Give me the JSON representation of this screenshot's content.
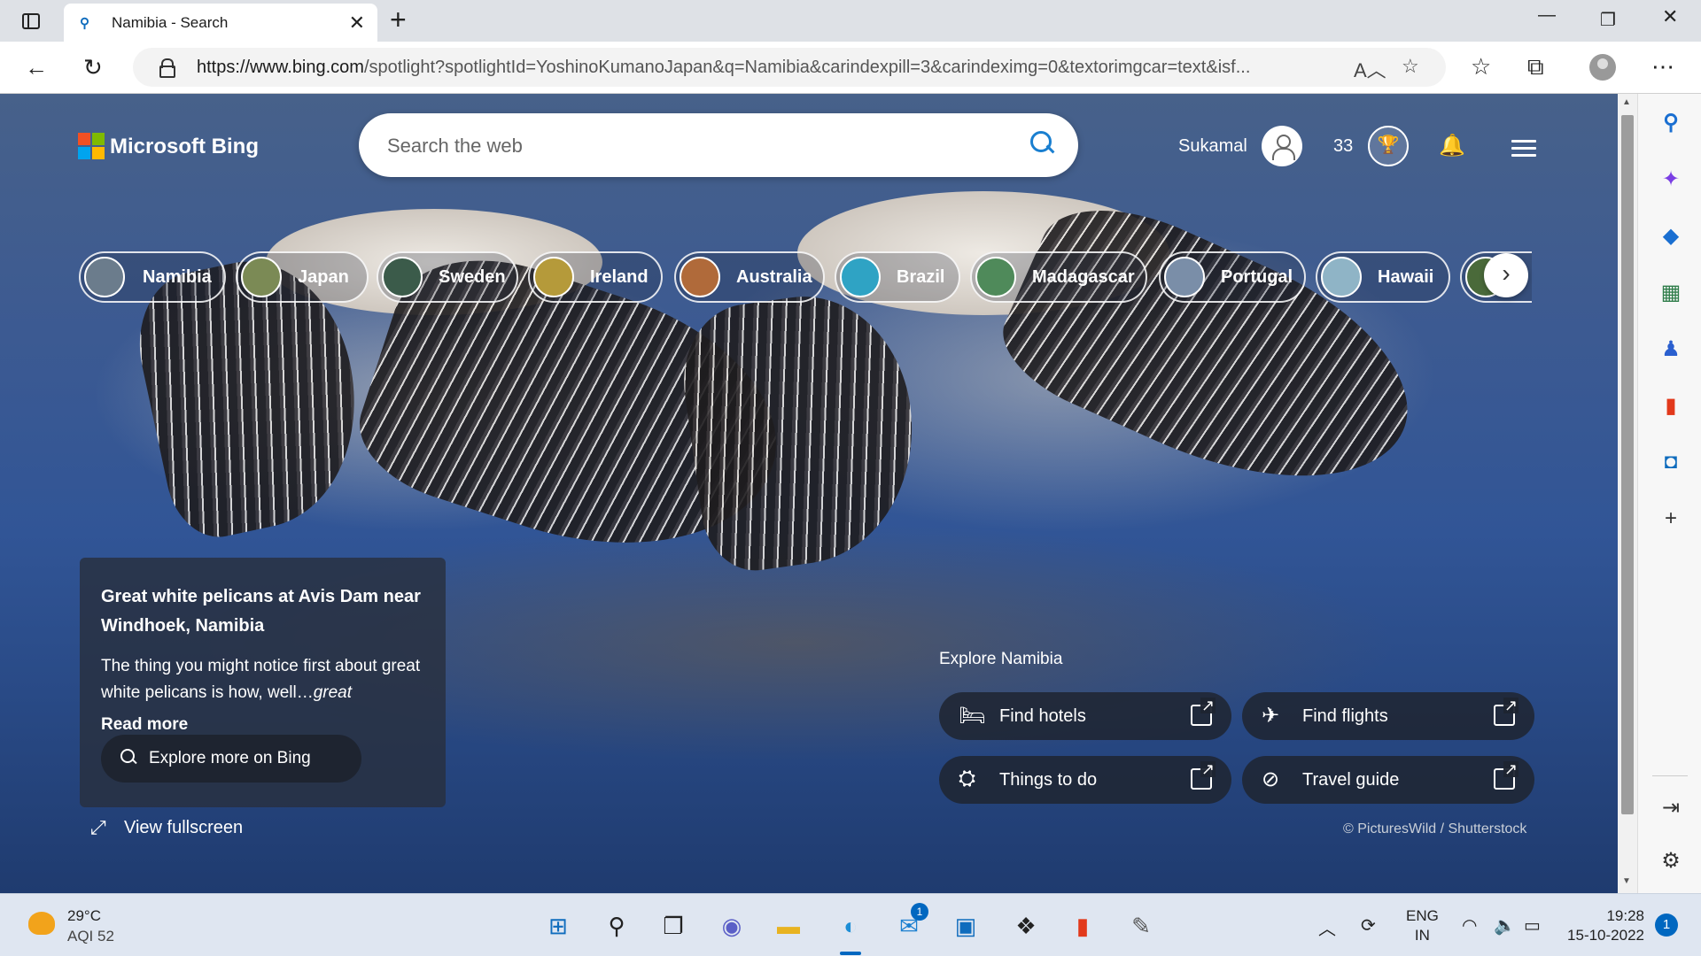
{
  "browser": {
    "tab_title": "Namibia - Search",
    "url_host": "https://www.bing.com",
    "url_rest": "/spotlight?spotlightId=YoshinoKumanoJapan&q=Namibia&carindexpill=3&carindeximg=0&textorimgcar=text&isf..."
  },
  "bing": {
    "logo_text": "Microsoft Bing",
    "search_placeholder": "Search the web",
    "user_name": "Sukamal",
    "points": "33",
    "pills": [
      {
        "label": "Namibia",
        "thumb_color": "#6b7c8c"
      },
      {
        "label": "Japan",
        "thumb_color": "#7b8a55"
      },
      {
        "label": "Sweden",
        "thumb_color": "#3b5b4a"
      },
      {
        "label": "Ireland",
        "thumb_color": "#b59a3a"
      },
      {
        "label": "Australia",
        "thumb_color": "#b06a3a"
      },
      {
        "label": "Brazil",
        "thumb_color": "#2fa3c4"
      },
      {
        "label": "Madagascar",
        "thumb_color": "#4f8a5a"
      },
      {
        "label": "Portugal",
        "thumb_color": "#7a8ea8"
      },
      {
        "label": "Hawaii",
        "thumb_color": "#8fb4c6"
      },
      {
        "label": "",
        "thumb_color": "#4a6a3a"
      }
    ],
    "info": {
      "headline": "Great white pelicans at Avis Dam near Windhoek, Namibia",
      "desc_plain": "The thing you might notice first about great white pelicans is how, well…",
      "desc_italic": "great",
      "read_more": "Read more",
      "explore_button": "Explore more on Bing"
    },
    "view_fullscreen": "View fullscreen",
    "explore_title": "Explore Namibia",
    "quick_links": [
      {
        "label": "Find hotels",
        "icon": "bed-icon",
        "glyph": "🛏"
      },
      {
        "label": "Find flights",
        "icon": "airplane-icon",
        "glyph": "✈"
      },
      {
        "label": "Things to do",
        "icon": "binoculars-icon",
        "glyph": "⛭"
      },
      {
        "label": "Travel guide",
        "icon": "compass-icon",
        "glyph": "⊘"
      }
    ],
    "credit": "© PicturesWild / Shutterstock"
  },
  "taskbar": {
    "temperature": "29°C",
    "aqi": "AQI 52",
    "lang_line1": "ENG",
    "lang_line2": "IN",
    "time": "19:28",
    "date": "15-10-2022",
    "notification_count": "1",
    "mail_badge": "1"
  },
  "colors": {
    "accent": "#0067c0",
    "bing_blue": "#1a7fd0"
  }
}
